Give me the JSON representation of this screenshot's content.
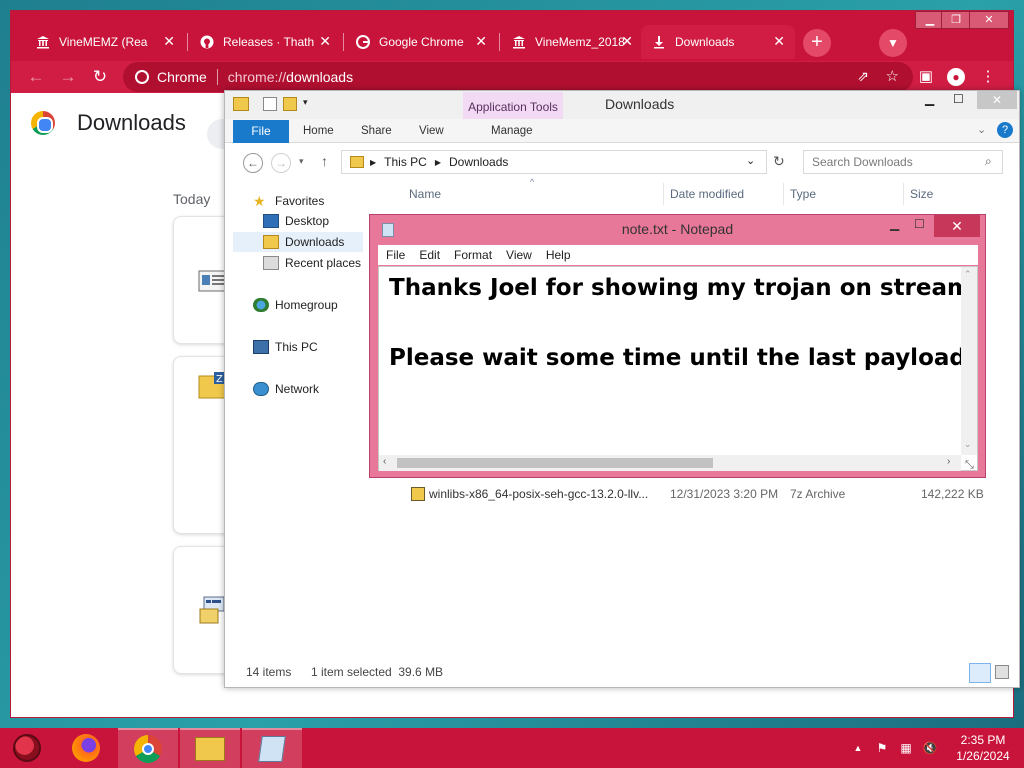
{
  "chrome": {
    "tabs": [
      {
        "label": "VineMEMZ (Rea",
        "icon": "museum-icon"
      },
      {
        "label": "Releases · Thath",
        "icon": "github-icon"
      },
      {
        "label": "Google Chrome",
        "icon": "google-icon"
      },
      {
        "label": "VineMemz_2018",
        "icon": "museum-icon"
      },
      {
        "label": "Downloads",
        "icon": "download-icon",
        "active": true
      }
    ],
    "close_glyph": "✕",
    "new_tab_glyph": "+",
    "omnibox": {
      "site_label": "Chrome",
      "url_prefix": "chrome://",
      "url_path": "downloads"
    },
    "page_title": "Downloads",
    "section_label": "Today",
    "accent_color": "#c8143a"
  },
  "explorer": {
    "title": "Downloads",
    "context_tab": "Application Tools",
    "ribbon_tabs": [
      "File",
      "Home",
      "Share",
      "View",
      "Manage"
    ],
    "breadcrumb": [
      "This PC",
      "Downloads"
    ],
    "search_placeholder": "Search Downloads",
    "nav": {
      "favorites": "Favorites",
      "desktop": "Desktop",
      "downloads": "Downloads",
      "recent": "Recent places",
      "homegroup": "Homegroup",
      "this_pc": "This PC",
      "network": "Network"
    },
    "columns": {
      "name": "Name",
      "date": "Date modified",
      "type": "Type",
      "size": "Size"
    },
    "visible_file": {
      "name": "winlibs-x86_64-posix-seh-gcc-13.2.0-llv...",
      "date": "12/31/2023 3:20 PM",
      "type": "7z Archive",
      "size": "142,222 KB"
    },
    "status": {
      "items": "14 items",
      "selected": "1 item selected  39.6 MB"
    }
  },
  "notepad": {
    "title": "note.txt - Notepad",
    "menu": [
      "File",
      "Edit",
      "Format",
      "View",
      "Help"
    ],
    "lines": [
      "Thanks Joel for showing my trojan on stream!",
      "Please wait some time until the last payload acti"
    ]
  },
  "taskbar": {
    "apps": [
      "ladybug-icon",
      "firefox-icon",
      "chrome-icon",
      "file-explorer-icon",
      "notepad-icon"
    ],
    "clock_time": "2:35 PM",
    "clock_date": "1/26/2024"
  }
}
